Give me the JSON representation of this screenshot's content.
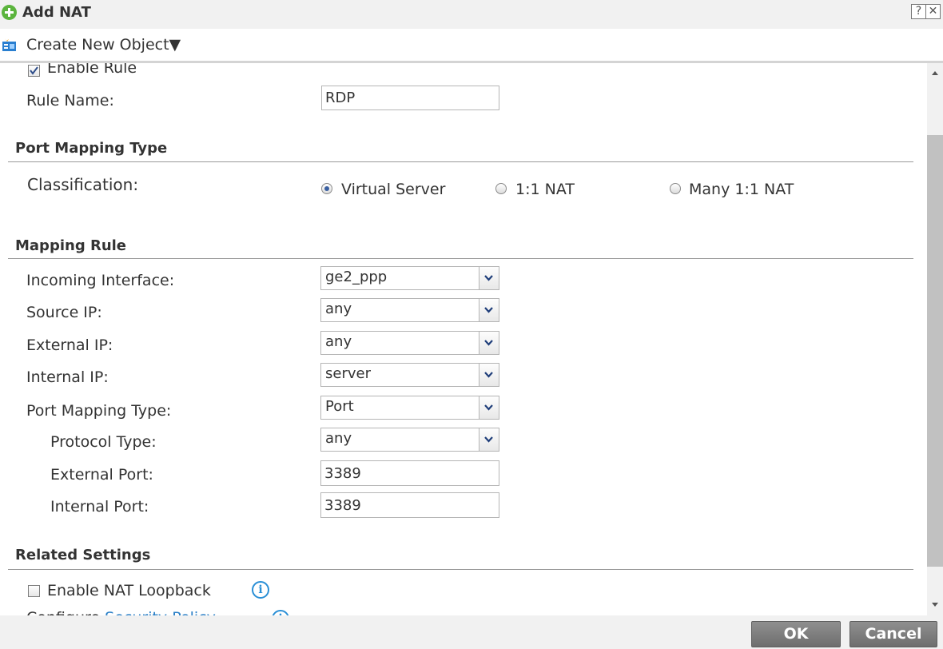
{
  "window": {
    "title": "Add NAT",
    "help_label": "?",
    "close_label": "✕"
  },
  "toolbar": {
    "create_object_label": "Create New Object▼"
  },
  "general": {
    "enable_rule_label": "Enable Rule",
    "enable_rule_checked": true,
    "rule_name_label": "Rule Name:",
    "rule_name_value": "RDP"
  },
  "port_mapping_type": {
    "section_title": "Port Mapping Type",
    "classification_label": "Classification:",
    "options": [
      {
        "label": "Virtual Server",
        "selected": true
      },
      {
        "label": "1:1 NAT",
        "selected": false
      },
      {
        "label": "Many 1:1 NAT",
        "selected": false
      }
    ]
  },
  "mapping_rule": {
    "section_title": "Mapping Rule",
    "incoming_interface_label": "Incoming Interface:",
    "incoming_interface_value": "ge2_ppp",
    "source_ip_label": "Source IP:",
    "source_ip_value": "any",
    "external_ip_label": "External IP:",
    "external_ip_value": "any",
    "internal_ip_label": "Internal IP:",
    "internal_ip_value": "server",
    "port_mapping_type_label": "Port Mapping Type:",
    "port_mapping_type_value": "Port",
    "protocol_type_label": "Protocol Type:",
    "protocol_type_value": "any",
    "external_port_label": "External Port:",
    "external_port_value": "3389",
    "internal_port_label": "Internal Port:",
    "internal_port_value": "3389"
  },
  "related_settings": {
    "section_title": "Related Settings",
    "nat_loopback_label": "Enable NAT Loopback",
    "nat_loopback_checked": false,
    "configure_prefix": "Configure",
    "security_policy_link": "Security Policy"
  },
  "footer": {
    "ok_label": "OK",
    "cancel_label": "Cancel"
  },
  "colors": {
    "accent_green": "#5bb43d",
    "info_blue": "#2a8fd6",
    "button_gray": "#7a7a7a"
  }
}
